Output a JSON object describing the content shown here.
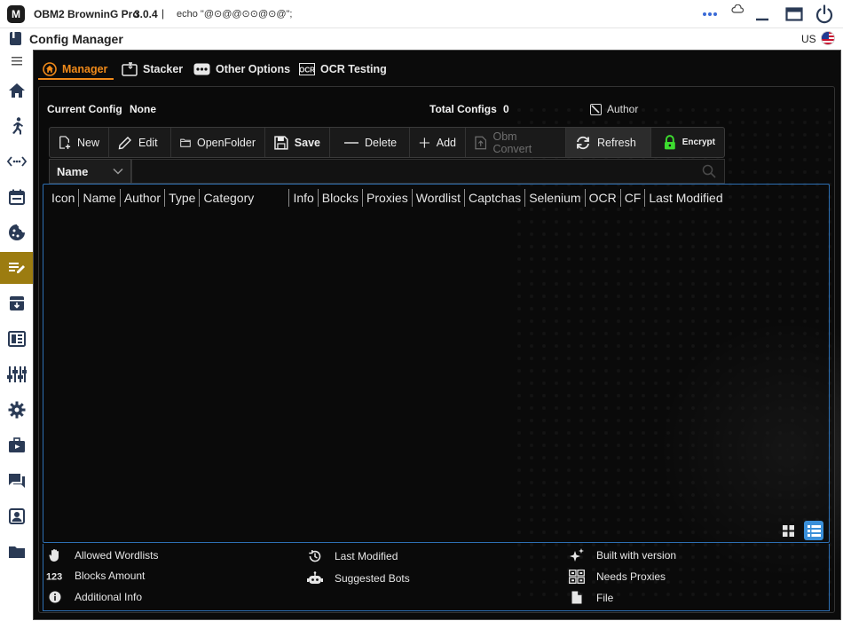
{
  "titlebar": {
    "logo": "M",
    "app_name": "OBM2 BrowninG Pro",
    "version": "3.0.4",
    "separator": "|",
    "echo": "echo \"@⊙@@⊙⊙@⊙@\";"
  },
  "subbar": {
    "page_title": "Config Manager",
    "language": "US"
  },
  "sidebar": {
    "items": [
      {
        "icon": "menu-icon"
      },
      {
        "icon": "home-icon"
      },
      {
        "icon": "runner-icon"
      },
      {
        "icon": "code-arrows-icon"
      },
      {
        "icon": "calendar-icon"
      },
      {
        "icon": "cookie-icon"
      },
      {
        "icon": "edit-notes-icon",
        "active": true
      },
      {
        "icon": "archive-icon"
      },
      {
        "icon": "dashboard-icon"
      },
      {
        "icon": "equalizer-icon"
      },
      {
        "icon": "gear-icon"
      },
      {
        "icon": "briefcase-play-icon"
      },
      {
        "icon": "chat-icon"
      },
      {
        "icon": "contact-icon"
      },
      {
        "icon": "folder-icon"
      }
    ]
  },
  "tabs": [
    {
      "label": "Manager",
      "active": true
    },
    {
      "label": "Stacker"
    },
    {
      "label": "Other Options"
    },
    {
      "label": "OCR Testing"
    }
  ],
  "info": {
    "current_config_label": "Current Config",
    "current_config_value": "None",
    "total_configs_label": "Total Configs",
    "total_configs_value": "0",
    "author_label": "Author"
  },
  "toolbar": {
    "new": "New",
    "edit": "Edit",
    "open_folder": "OpenFolder",
    "save": "Save",
    "delete": "Delete",
    "add": "Add",
    "obm_convert": "Obm Convert",
    "refresh": "Refresh",
    "encrypt": "Encrypt"
  },
  "search": {
    "field": "Name",
    "value": ""
  },
  "table": {
    "columns": [
      "Icon",
      "Name",
      "Author",
      "Type",
      "Category",
      "Info",
      "Blocks",
      "Proxies",
      "Wordlist",
      "Captchas",
      "Selenium",
      "OCR",
      "CF",
      "Last Modified"
    ]
  },
  "legend": {
    "allowed_wordlists": "Allowed Wordlists",
    "blocks_amount": "Blocks Amount",
    "additional_info": "Additional Info",
    "last_modified": "Last Modified",
    "suggested_bots": "Suggested Bots",
    "built_with_version": "Built with version",
    "needs_proxies": "Needs Proxies",
    "file": "File"
  },
  "colors": {
    "accent": "#f08a1a",
    "sidebar_active": "#9c7c10",
    "table_border": "#2d6fb3",
    "encrypt_lock": "#3ddc2f"
  }
}
